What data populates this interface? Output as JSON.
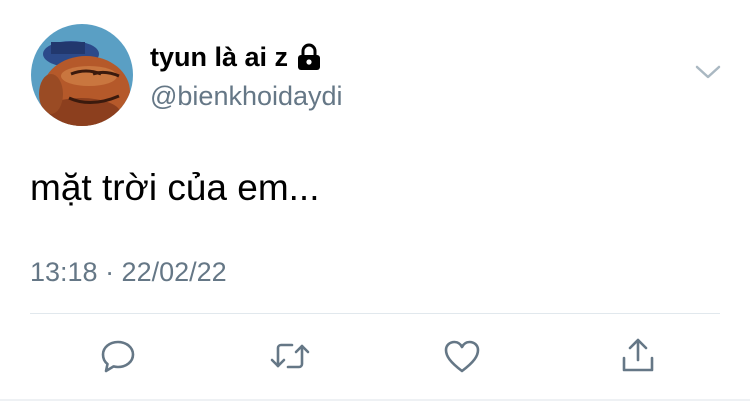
{
  "tweet": {
    "display_name": "tyun là ai z",
    "handle": "@bienkhoidaydi",
    "text": "mặt trời của em...",
    "timestamp": "13:18 · 22/02/22",
    "protected_account": true
  },
  "icons": {
    "lock": "lock-icon",
    "more": "chevron-down-icon",
    "reply": "reply-icon",
    "retweet": "retweet-icon",
    "like": "heart-icon",
    "share": "share-icon"
  },
  "colors": {
    "text_primary": "#000000",
    "text_secondary": "#657786",
    "icon": "#657786",
    "divider": "#e1e8ed"
  }
}
